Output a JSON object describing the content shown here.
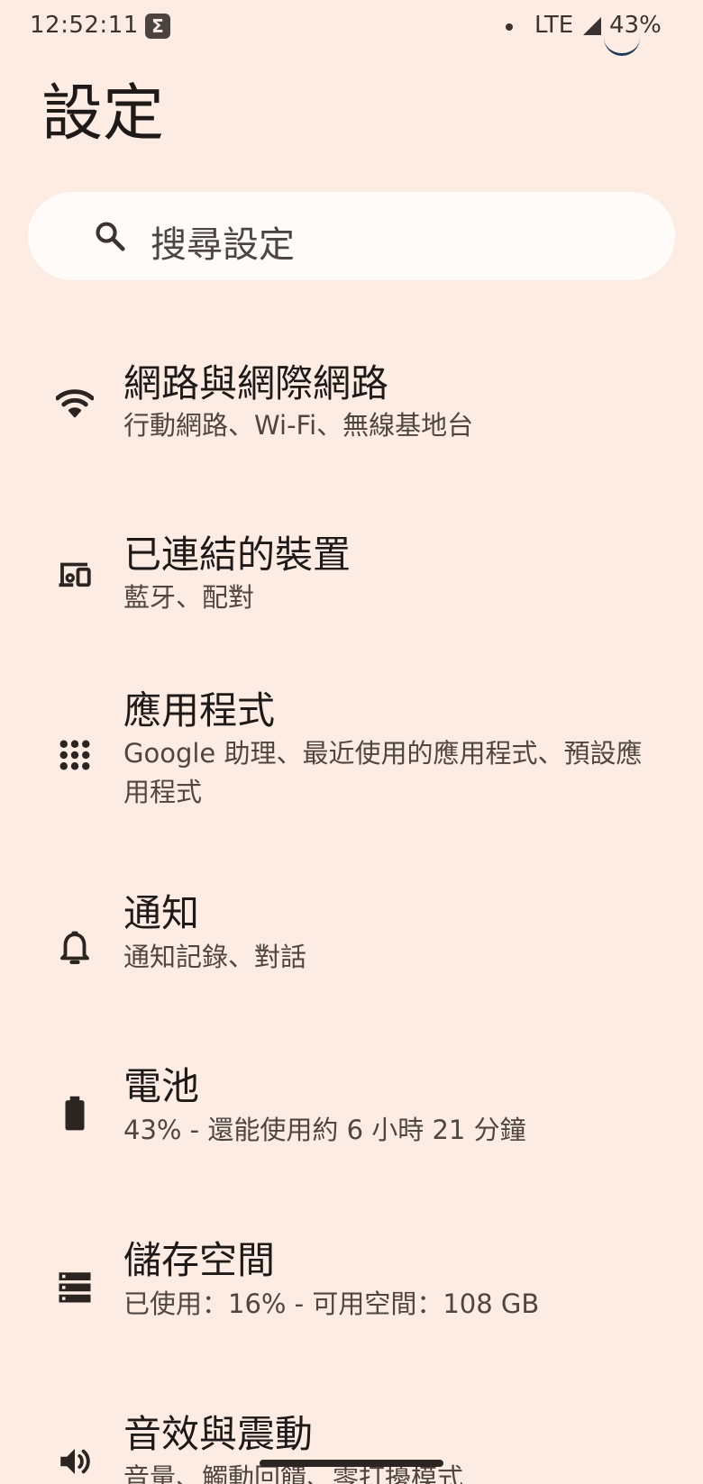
{
  "status_bar": {
    "time": "12:52:11",
    "app_icon_glyph": "Σ",
    "network": "LTE",
    "battery": "43%"
  },
  "page": {
    "title": "設定"
  },
  "search": {
    "placeholder": "搜尋設定"
  },
  "settings": [
    {
      "icon": "wifi-icon",
      "title": "網路與網際網路",
      "subtitle": "行動網路、Wi-Fi、無線基地台"
    },
    {
      "icon": "devices-icon",
      "title": "已連結的裝置",
      "subtitle": "藍牙、配對"
    },
    {
      "icon": "apps-grid-icon",
      "title": "應用程式",
      "subtitle": "Google 助理、最近使用的應用程式、預設應用程式"
    },
    {
      "icon": "bell-icon",
      "title": "通知",
      "subtitle": "通知記錄、對話"
    },
    {
      "icon": "battery-icon",
      "title": "電池",
      "subtitle": "43% - 還能使用約 6 小時 21 分鐘"
    },
    {
      "icon": "storage-icon",
      "title": "儲存空間",
      "subtitle": "已使用：16% - 可用空間：108 GB"
    },
    {
      "icon": "speaker-icon",
      "title": "音效與震動",
      "subtitle": "音量、觸動回饋、零打擾模式"
    }
  ],
  "colors": {
    "background": "#fdece4",
    "search_background": "#fffbf8",
    "text_primary": "#1f1a17",
    "text_secondary": "#4f4642"
  }
}
